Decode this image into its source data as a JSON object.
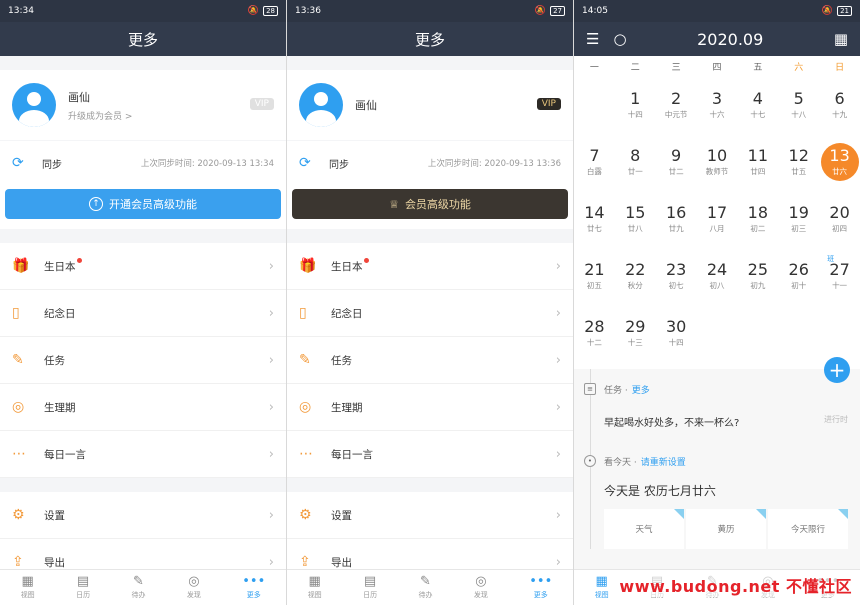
{
  "screen1": {
    "status": {
      "time": "13:34",
      "battery": "28"
    },
    "title": "更多",
    "profile": {
      "name": "画仙",
      "sub": "升级成为会员 >",
      "vip": "VIP"
    },
    "sync": {
      "label": "同步",
      "time": "上次同步时间:  2020-09-13 13:34"
    },
    "button": "开通会员高级功能",
    "menu": [
      "生日本",
      "纪念日",
      "任务",
      "生理期",
      "每日一言"
    ],
    "settings": [
      "设置",
      "导出"
    ]
  },
  "screen2": {
    "status": {
      "time": "13:36",
      "battery": "27"
    },
    "title": "更多",
    "profile": {
      "name": "画仙",
      "vip": "VIP"
    },
    "sync": {
      "label": "同步",
      "time": "上次同步时间:  2020-09-13 13:36"
    },
    "button": "会员高级功能",
    "menu": [
      "生日本",
      "纪念日",
      "任务",
      "生理期",
      "每日一言"
    ],
    "settings": [
      "设置",
      "导出"
    ]
  },
  "tabs": [
    "视图",
    "日历",
    "待办",
    "发现",
    "更多"
  ],
  "calendar": {
    "status": {
      "time": "14:05",
      "battery": "21"
    },
    "title": "2020.09",
    "weekdays": [
      "一",
      "二",
      "三",
      "四",
      "五",
      "六",
      "日"
    ],
    "days": [
      {
        "n": "",
        "l": ""
      },
      {
        "n": "1",
        "l": "十四"
      },
      {
        "n": "2",
        "l": "中元节"
      },
      {
        "n": "3",
        "l": "十六"
      },
      {
        "n": "4",
        "l": "十七"
      },
      {
        "n": "5",
        "l": "十八"
      },
      {
        "n": "6",
        "l": "十九"
      },
      {
        "n": "7",
        "l": "白露"
      },
      {
        "n": "8",
        "l": "廿一"
      },
      {
        "n": "9",
        "l": "廿二"
      },
      {
        "n": "10",
        "l": "教师节"
      },
      {
        "n": "11",
        "l": "廿四"
      },
      {
        "n": "12",
        "l": "廿五"
      },
      {
        "n": "13",
        "l": "廿六"
      },
      {
        "n": "14",
        "l": "廿七"
      },
      {
        "n": "15",
        "l": "廿八"
      },
      {
        "n": "16",
        "l": "廿九"
      },
      {
        "n": "17",
        "l": "八月"
      },
      {
        "n": "18",
        "l": "初二"
      },
      {
        "n": "19",
        "l": "初三"
      },
      {
        "n": "20",
        "l": "初四"
      },
      {
        "n": "21",
        "l": "初五"
      },
      {
        "n": "22",
        "l": "秋分"
      },
      {
        "n": "23",
        "l": "初七"
      },
      {
        "n": "24",
        "l": "初八"
      },
      {
        "n": "25",
        "l": "初九"
      },
      {
        "n": "26",
        "l": "初十"
      },
      {
        "n": "27",
        "l": "十一"
      },
      {
        "n": "28",
        "l": "十二"
      },
      {
        "n": "29",
        "l": "十三"
      },
      {
        "n": "30",
        "l": "十四"
      }
    ],
    "ban_label": "班",
    "task_section": "任务 · ",
    "task_more": "更多",
    "task_text": "早起喝水好处多，不来一杯么?",
    "task_status": "进行时",
    "look_section": "看今天 · ",
    "look_link": "请重新设置",
    "today_text": "今天是 农历七月廿六",
    "cards": [
      "天气",
      "黄历",
      "今天限行"
    ]
  },
  "watermark": "www.budong.net 不懂社区"
}
